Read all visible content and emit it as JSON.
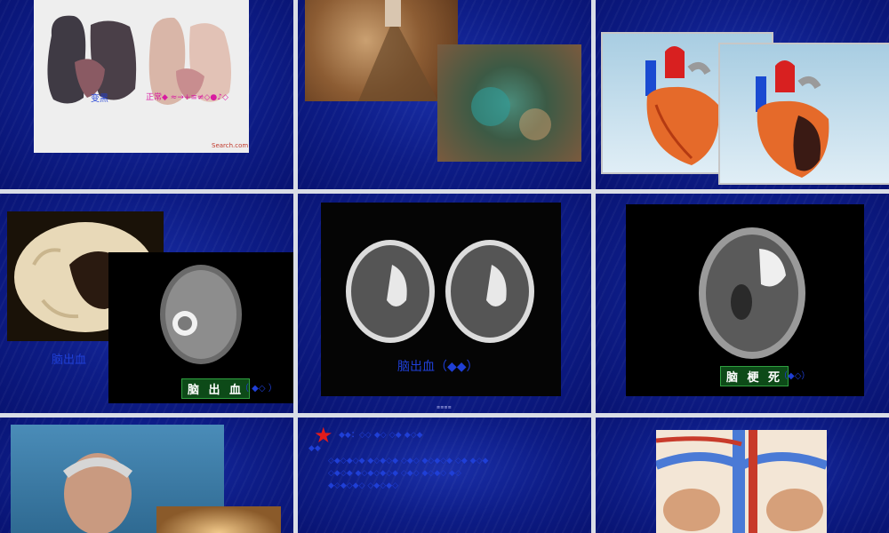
{
  "tiles": {
    "lungs": {
      "caption_left": "变黑",
      "caption_right": "正常◆ ≈→+≡≠◇●♪◇",
      "watermark": "Search.com"
    },
    "brain_hemorrhage_specimen": {
      "caption_left": "脑出血",
      "caption_box": "脑 出 血",
      "caption_paren": "（ ◆◇ ）"
    },
    "ct_hemorrhage": {
      "caption": "脑出血（◆◆）",
      "slide_number": "≡≡≡≡"
    },
    "mri_infarct": {
      "caption_box": "脑 梗 死",
      "caption_paren": "（◆◇）"
    },
    "text_slide": {
      "star": "★",
      "heading": "◆◆：◇◇ ◆◇ ◇◆ ◆◇◆",
      "line1": "◆◆",
      "paragraph": "◇◆◇◆◇◆ ◆◇◆◇◆ ◇◆◇ ◆◇◆◇◆ ◇◆ ◆◇◆ ◇◆◇◆ ◆◇◆◇◆◇◆ ◇◆◇ ◆◇◆◇ ◆◇ ◆◇◆◇◆◇ ◇◆◇◆◇"
    }
  },
  "colors": {
    "tile_bg": "#0d1c86",
    "caption_blue": "#1f3fd6",
    "caption_magenta": "#d81aa0",
    "star_red": "#e31b1b"
  }
}
